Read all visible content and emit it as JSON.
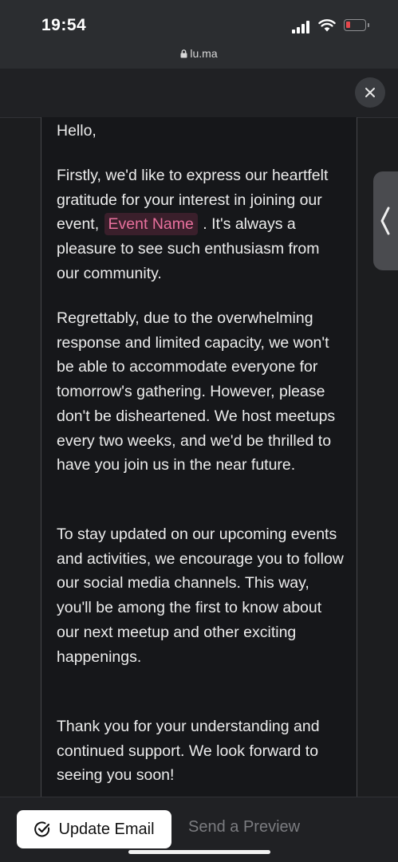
{
  "status_bar": {
    "time": "19:54",
    "url": "lu.ma"
  },
  "email": {
    "greeting": "Hello,",
    "para1_before": "Firstly, we'd like to express our heartfelt gratitude for your interest in joining our event, ",
    "event_tag": "Event Name",
    "para1_after": " . It's always a pleasure to see such enthusiasm from our community.",
    "para2": "Regrettably, due to the overwhelming response and limited capacity, we won't be able to accommodate everyone for tomorrow's gathering. However, please don't be disheartened. We host meetups every two weeks, and we'd be thrilled to have you join us in the near future.",
    "para3": "To stay updated on our upcoming events and activities, we encourage you to follow our social media channels. This way, you'll be among the first to know about our next meetup and other exciting happenings.",
    "para4": "Thank you for your understanding and continued support. We look forward to seeing you soon!"
  },
  "footer": {
    "update_label": "Update Email",
    "preview_label": "Send a Preview"
  },
  "icons": {
    "close": "close-icon",
    "check": "check-circle-icon",
    "lock": "lock-icon",
    "side_tab": "chevron-left-icon"
  },
  "colors": {
    "event_tag_text": "#e8709d",
    "event_tag_bg": "#3a1f2b",
    "battery_low": "#e5484d"
  }
}
